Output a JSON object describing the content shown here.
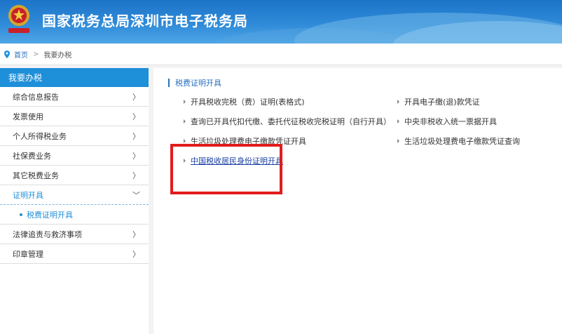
{
  "header": {
    "site_title": "国家税务总局深圳市电子税务局",
    "emblem_icon": "tax-emblem-icon",
    "brand_color": "#1d74c8"
  },
  "breadcrumb": {
    "home": "首页",
    "separator": ">",
    "current": "我要办税"
  },
  "sidebar": {
    "title": "我要办税",
    "items": [
      {
        "label": "综合信息报告",
        "arrow": "〉"
      },
      {
        "label": "发票使用",
        "arrow": "〉"
      },
      {
        "label": "个人所得税业务",
        "arrow": "〉"
      },
      {
        "label": "社保费业务",
        "arrow": "〉"
      },
      {
        "label": "其它税费业务",
        "arrow": "〉"
      },
      {
        "label": "证明开具",
        "arrow": "﹀"
      },
      {
        "label": "法律追责与救济事项",
        "arrow": "〉"
      },
      {
        "label": "印章管理",
        "arrow": "〉"
      }
    ],
    "sub_item": "税费证明开具",
    "accent_color": "#1e8fd9"
  },
  "main": {
    "section_title": "税费证明开具",
    "links": [
      "开具税收完税（费）证明(表格式)",
      "开具电子缴(退)款凭证",
      "查询已开具代扣代缴、委托代征税收完税证明（自行开具）",
      "中央非税收入统一票据开具",
      "生活垃圾处理费电子缴款凭证开具",
      "生活垃圾处理费电子缴款凭证查询",
      "中国税收居民身份证明开具"
    ],
    "highlight_color": "#e21c1c"
  }
}
